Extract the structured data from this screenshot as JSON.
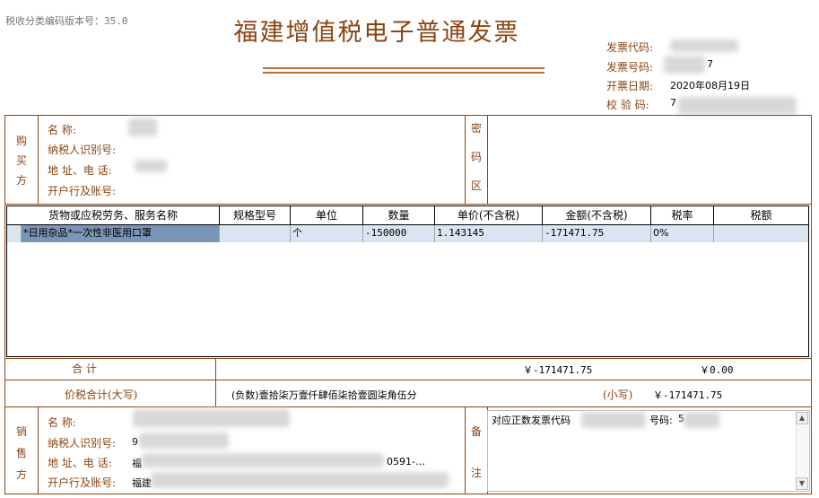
{
  "version": {
    "label": "税收分类编码版本号：35.0"
  },
  "title": "福建增值税电子普通发票",
  "header": {
    "code_label": "发票代码:",
    "number_label": "发票号码:",
    "number_partial": "7",
    "date_label": "开票日期:",
    "date_value": "2020年08月19日",
    "check_label": "校 验 码:",
    "check_partial": "7"
  },
  "buyer": {
    "section_label": [
      "购",
      "买",
      "方"
    ],
    "name_label": "名          称:",
    "tax_id_label": "纳税人识别号:",
    "address_label": "地  址、电  话:",
    "bank_label": "开户行及账号:"
  },
  "cipher": {
    "section_label": [
      "密",
      "码",
      "区"
    ]
  },
  "goods": {
    "columns": [
      "货物或应税劳务、服务名称",
      "规格型号",
      "单位",
      "数量",
      "单价(不含税)",
      "金额(不含税)",
      "税率",
      "税额"
    ],
    "rows": [
      {
        "name": "*日用杂品*一次性非医用口罩",
        "spec": "",
        "unit": "个",
        "qty": "-150000",
        "price": "1.143145",
        "amount": "-171471.75",
        "rate": "0%",
        "tax": ""
      }
    ]
  },
  "totals": {
    "label": "合        计",
    "amount": "￥-171471.75",
    "tax": "￥0.00",
    "total_label": "价税合计(大写)",
    "total_words": "(负数)壹拾柒万壹仟肆佰柒拾壹圆柒角伍分",
    "small_label": "(小写)",
    "total_small": "￥-171471.75"
  },
  "seller": {
    "section_label": [
      "销",
      "售",
      "方"
    ],
    "name_label": "名          称:",
    "tax_id_label": "纳税人识别号:",
    "tax_id_partial": "9",
    "address_label": "地  址、电  话:",
    "address_partial_start": "福",
    "address_partial_end": "0591-…",
    "bank_label": "开户行及账号:",
    "bank_partial": "福建"
  },
  "remarks": {
    "section_label": [
      "备",
      "注"
    ],
    "text_prefix": "对应正数发票代码",
    "text_mid": "号码:",
    "text_partial": "5"
  }
}
